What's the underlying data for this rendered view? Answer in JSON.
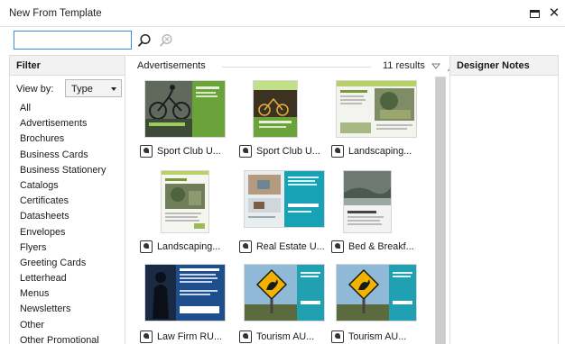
{
  "window": {
    "title": "New From Template",
    "maximize_icon": "maximize-icon",
    "close_glyph": "✕"
  },
  "search": {
    "value": "",
    "placeholder": "",
    "search_icon": "search-icon",
    "clear_icon": "clear-search-icon"
  },
  "filter": {
    "header": "Filter",
    "view_by_label": "View by:",
    "view_by_value": "Type",
    "items": [
      "All",
      "Advertisements",
      "Brochures",
      "Business Cards",
      "Business Stationery",
      "Catalogs",
      "Certificates",
      "Datasheets",
      "Envelopes",
      "Flyers",
      "Greeting Cards",
      "Letterhead",
      "Menus",
      "Newsletters",
      "Other",
      "Other Promotional"
    ]
  },
  "results": {
    "category": "Advertisements",
    "count": "11 results",
    "templates": [
      {
        "label": "Sport Club U..."
      },
      {
        "label": "Sport Club U..."
      },
      {
        "label": "Landscaping..."
      },
      {
        "label": "Landscaping..."
      },
      {
        "label": "Real Estate U..."
      },
      {
        "label": "Bed & Breakf..."
      },
      {
        "label": "Law Firm RU..."
      },
      {
        "label": "Tourism AU..."
      },
      {
        "label": "Tourism AU..."
      }
    ]
  },
  "notes": {
    "header": "Designer Notes"
  },
  "colors": {
    "accent": "#3d8ee0",
    "sport_green": "#6aa33a",
    "estate_teal": "#17a3b5",
    "law_blue": "#1f4e8c",
    "tourism_teal": "#20a0b0"
  }
}
